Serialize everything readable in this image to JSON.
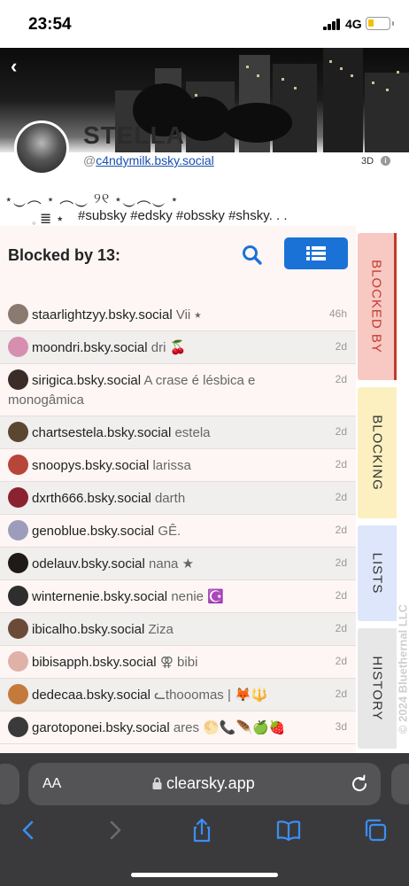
{
  "status": {
    "time": "23:54",
    "network": "4G"
  },
  "profile": {
    "name": "STELLA",
    "handle_prefix": "@",
    "handle": "c4ndymilk.bsky.social",
    "badge_3d": "3D",
    "bio_decoration_line1": "⋆‿︵ ⋆ ︵‿ ୨୧ ⋆‿︵‿ ⋆",
    "bio_decoration_line2": "𓈒 ≣ ⋆",
    "bio_tags": "#subsky #edsky #obssky #shsky. . ."
  },
  "panel": {
    "title": "Blocked by 13:"
  },
  "rows": [
    {
      "user": "staarlightzyy.bsky.social",
      "display": "Vii ⭑",
      "time": "46h",
      "avatar_color": "#8a7a70"
    },
    {
      "user": "moondri.bsky.social",
      "display": "dri 🍒",
      "time": "2d",
      "avatar_color": "#d78fb0"
    },
    {
      "user": "sirigica.bsky.social",
      "display": "A crase é lésbica e monogâmica",
      "time": "2d",
      "avatar_color": "#3b2c28"
    },
    {
      "user": "chartsestela.bsky.social",
      "display": "estela",
      "time": "2d",
      "avatar_color": "#5b4630"
    },
    {
      "user": "snoopys.bsky.social",
      "display": "larissa",
      "time": "2d",
      "avatar_color": "#b8453a"
    },
    {
      "user": "dxrth666.bsky.social",
      "display": "darth",
      "time": "2d",
      "avatar_color": "#8b2230"
    },
    {
      "user": "genoblue.bsky.social",
      "display": "GÊ.",
      "time": "2d",
      "avatar_color": "#9d9dbb"
    },
    {
      "user": "odelauv.bsky.social",
      "display": "nana ★",
      "time": "2d",
      "avatar_color": "#1f1a18"
    },
    {
      "user": "winternenie.bsky.social",
      "display": "nenie ☪️",
      "time": "2d",
      "avatar_color": "#2e2e2e"
    },
    {
      "user": "ibicalho.bsky.social",
      "display": "Ziza",
      "time": "2d",
      "avatar_color": "#6b4a38"
    },
    {
      "user": "bibisapph.bsky.social",
      "display": "⚢ bibi",
      "time": "2d",
      "avatar_color": "#e0b1a8"
    },
    {
      "user": "dedecaa.bsky.social",
      "display": "ᓚthooomas | 🦊🔱",
      "time": "2d",
      "avatar_color": "#c47a3a"
    },
    {
      "user": "garotoponei.bsky.social",
      "display": "ares 🌕📞🪶🍏🍓",
      "time": "3d",
      "avatar_color": "#3a3a3a"
    }
  ],
  "side_tabs": {
    "blocked_by": "BLOCKED BY",
    "blocking": "BLOCKING",
    "lists": "LISTS",
    "history": "HISTORY",
    "colors": {
      "blocked_by_bg": "#f8c8c3",
      "blocked_by_text": "#c23a2c",
      "blocking_bg": "#fcf0c0",
      "lists_bg": "#dde6fa",
      "history_bg": "#e7e7e7"
    }
  },
  "copyright": "© 2024 Bluethernal LLC",
  "browser": {
    "aa_label": "AA",
    "url": "clearsky.app"
  },
  "accent": "#1b72d6"
}
